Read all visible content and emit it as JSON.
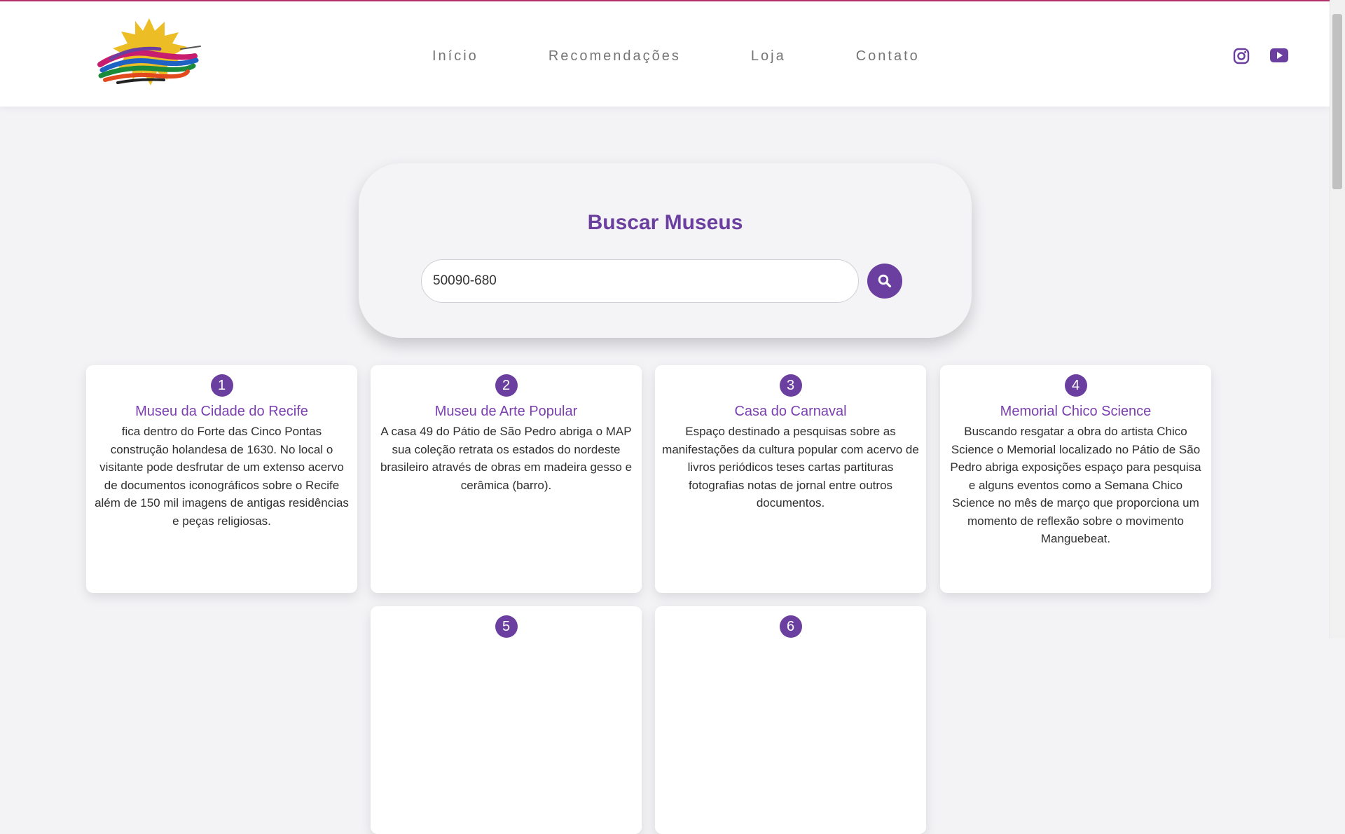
{
  "header": {
    "nav": [
      "Início",
      "Recomendações",
      "Loja",
      "Contato"
    ],
    "social": [
      "instagram-icon",
      "youtube-icon"
    ]
  },
  "search": {
    "title": "Buscar Museus",
    "value": "50090-680"
  },
  "cards": [
    {
      "number": "1",
      "title": "Museu da Cidade do Recife",
      "text": "fica dentro do Forte das Cinco Pontas construção holandesa de 1630. No local o visitante pode desfrutar de um extenso acervo de documentos iconográficos sobre o Recife além de 150 mil imagens de antigas residências e peças religiosas."
    },
    {
      "number": "2",
      "title": "Museu de Arte Popular",
      "text": "A casa 49 do Pátio de São Pedro abriga o MAP sua coleção retrata os estados do nordeste brasileiro através de obras em madeira gesso e cerâmica (barro)."
    },
    {
      "number": "3",
      "title": "Casa do Carnaval",
      "text": "Espaço destinado a pesquisas sobre as manifestações da cultura popular com acervo de livros periódicos teses cartas partituras fotografias notas de jornal entre outros documentos."
    },
    {
      "number": "4",
      "title": "Memorial Chico Science",
      "text": "Buscando resgatar a obra do artista Chico Science o Memorial localizado no Pátio de São Pedro abriga exposições espaço para pesquisa e alguns eventos como a Semana Chico Science no mês de março que proporciona um momento de reflexão sobre o movimento Manguebeat."
    },
    {
      "number": "5",
      "title": "",
      "text": ""
    },
    {
      "number": "6",
      "title": "",
      "text": ""
    }
  ],
  "colors": {
    "accent": "#6b3fa0",
    "topline": "#b5326b",
    "logo_sun": "#ecbd24"
  }
}
